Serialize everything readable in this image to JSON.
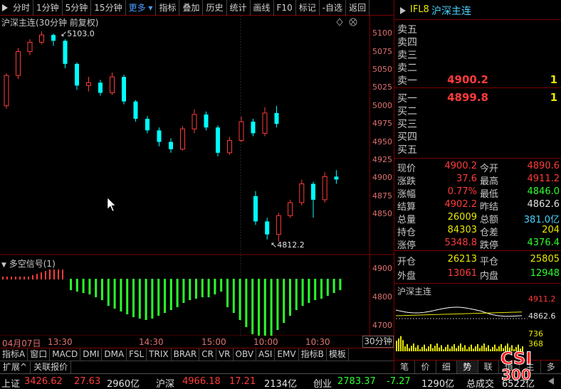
{
  "toolbar": {
    "items": [
      "分时",
      "1分钟",
      "5分钟",
      "15分钟",
      "更多",
      "指标",
      "叠加",
      "历史",
      "统计",
      "画线",
      "F10",
      "标记",
      "-自选",
      "返回"
    ]
  },
  "contract": {
    "code": "IFL8",
    "name": "沪深主连"
  },
  "order_book": {
    "asks": [
      {
        "label": "卖五",
        "price": "",
        "vol": ""
      },
      {
        "label": "卖四",
        "price": "",
        "vol": ""
      },
      {
        "label": "卖三",
        "price": "",
        "vol": ""
      },
      {
        "label": "卖二",
        "price": "",
        "vol": ""
      },
      {
        "label": "卖一",
        "price": "4900.2",
        "vol": "1"
      }
    ],
    "bids": [
      {
        "label": "买一",
        "price": "4899.8",
        "vol": "1"
      },
      {
        "label": "买二",
        "price": "",
        "vol": ""
      },
      {
        "label": "买三",
        "price": "",
        "vol": ""
      },
      {
        "label": "买四",
        "price": "",
        "vol": ""
      },
      {
        "label": "买五",
        "price": "",
        "vol": ""
      }
    ]
  },
  "quote": [
    {
      "l1": "现价",
      "v1": "4900.2",
      "c1": "red",
      "l2": "今开",
      "v2": "4890.6",
      "c2": "red"
    },
    {
      "l1": "涨跌",
      "v1": "37.6",
      "c1": "red",
      "l2": "最高",
      "v2": "4911.2",
      "c2": "red"
    },
    {
      "l1": "涨幅",
      "v1": "0.77%",
      "c1": "red",
      "l2": "最低",
      "v2": "4846.0",
      "c2": "green"
    },
    {
      "l1": "结算",
      "v1": "4902.2",
      "c1": "red",
      "l2": "昨结",
      "v2": "4862.6",
      "c2": "white"
    },
    {
      "l1": "总量",
      "v1": "26009",
      "c1": "yellow",
      "l2": "总额",
      "v2": "381.0亿",
      "c2": "cyan"
    },
    {
      "l1": "持仓",
      "v1": "84303",
      "c1": "yellow",
      "l2": "仓差",
      "v2": "204",
      "c2": "yellow"
    },
    {
      "l1": "涨停",
      "v1": "5348.8",
      "c1": "red",
      "l2": "跌停",
      "v2": "4376.4",
      "c2": "green"
    }
  ],
  "quote2": [
    {
      "l1": "开仓",
      "v1": "26213",
      "c1": "yellow",
      "l2": "平仓",
      "v2": "25805",
      "c2": "yellow"
    },
    {
      "l1": "外盘",
      "v1": "13061",
      "c1": "red",
      "l2": "内盘",
      "v2": "12948",
      "c2": "green"
    }
  ],
  "mini_chart": {
    "title": "沪深主连",
    "high": "4911.2",
    "mid": "4862.6",
    "vol_top": "736",
    "vol_mid": "368",
    "tabs": [
      "笔",
      "价",
      "细",
      "势",
      "联",
      "值",
      "主",
      "多"
    ],
    "active_tab": "势"
  },
  "main_chart": {
    "title": "沪深主连(30分钟 前复权)",
    "max_label": "5103.0",
    "min_label": "4812.2",
    "y_ticks": [
      "5100",
      "5075",
      "5050",
      "5025",
      "5000",
      "4975",
      "4950",
      "4925",
      "4900",
      "4875",
      "4850"
    ],
    "time_labels": [
      "04月07日",
      "13:30",
      "14:30",
      "15:00",
      "10:00",
      "10:30"
    ]
  },
  "indicator": {
    "title": "多空信号(1)",
    "y_ticks": [
      "4900",
      "4800",
      "4700"
    ]
  },
  "indicator_tabs": [
    "指标A",
    "窗口",
    "MACD",
    "DMI",
    "DMA",
    "FSL",
    "TRIX",
    "BRAR",
    "CR",
    "VR",
    "OBV",
    "ASI",
    "EMV",
    "指标B",
    "模板"
  ],
  "period_label": "30分钟",
  "extra_tabs": [
    "扩展^",
    "关联报价"
  ],
  "status_bar": [
    {
      "name": "上证",
      "price": "3426.62",
      "chg": "27.63",
      "amt": "2960亿",
      "pc": "red",
      "cc": "red"
    },
    {
      "name": "沪深",
      "price": "4966.18",
      "chg": "17.21",
      "amt": "2134亿",
      "pc": "red",
      "cc": "red"
    },
    {
      "name": "创业",
      "price": "2783.37",
      "chg": "-7.27",
      "amt": "1290亿",
      "pc": "green",
      "cc": "green"
    }
  ],
  "status_total": "总成交",
  "status_total_val": "6522亿",
  "logo": {
    "line1": "CSI",
    "line2": "300"
  },
  "colors": {
    "up": "#ff3b3b",
    "down": "#00ffff",
    "frame": "#7a0000",
    "signal_green": "#2bff2b"
  },
  "candles": [
    [
      5000,
      5042,
      5045,
      4996
    ],
    [
      5042,
      5075,
      5080,
      5037
    ],
    [
      5075,
      5088,
      5092,
      5070
    ],
    [
      5088,
      5098,
      5103,
      5085
    ],
    [
      5098,
      5090,
      5100,
      5083
    ],
    [
      5090,
      5058,
      5092,
      5052
    ],
    [
      5058,
      5028,
      5060,
      5022
    ],
    [
      5028,
      5032,
      5040,
      5020
    ],
    [
      5032,
      5018,
      5036,
      5014
    ],
    [
      5018,
      5040,
      5046,
      5015
    ],
    [
      5040,
      5006,
      5043,
      5002
    ],
    [
      5006,
      4982,
      5008,
      4978
    ],
    [
      4982,
      4966,
      4986,
      4962
    ],
    [
      4966,
      4950,
      4970,
      4944
    ],
    [
      4950,
      4940,
      4955,
      4935
    ],
    [
      4940,
      4968,
      4972,
      4938
    ],
    [
      4968,
      4988,
      4995,
      4962
    ],
    [
      4988,
      4970,
      4992,
      4966
    ],
    [
      4970,
      4935,
      4973,
      4930
    ],
    [
      4935,
      4952,
      4957,
      4932
    ],
    [
      4952,
      4978,
      4985,
      4950
    ],
    [
      4978,
      4962,
      4982,
      4958
    ],
    [
      4962,
      4990,
      4998,
      4958
    ],
    [
      4990,
      4975,
      5000,
      4970
    ],
    [
      4875,
      4840,
      4882,
      4835
    ],
    [
      4840,
      4822,
      4845,
      4815
    ],
    [
      4822,
      4848,
      4852,
      4812
    ],
    [
      4848,
      4866,
      4870,
      4845
    ],
    [
      4866,
      4892,
      4898,
      4862
    ],
    [
      4892,
      4870,
      4895,
      4845
    ],
    [
      4870,
      4902,
      4908,
      4866
    ],
    [
      4902,
      4898,
      4911,
      4892
    ]
  ],
  "signal": {
    "red": [
      2,
      2,
      2,
      2,
      2,
      2,
      2,
      3,
      4,
      5,
      6,
      7,
      7,
      7,
      7
    ],
    "green": [
      16,
      18,
      20,
      22,
      26,
      30,
      38,
      42,
      46,
      50,
      54,
      56,
      58,
      56,
      52,
      48,
      44,
      40,
      34,
      30,
      28,
      26,
      26,
      22,
      18,
      40,
      48,
      58,
      68,
      78,
      86,
      88,
      80,
      72,
      62,
      52,
      44,
      38,
      34,
      30,
      28,
      24,
      20,
      16
    ]
  }
}
